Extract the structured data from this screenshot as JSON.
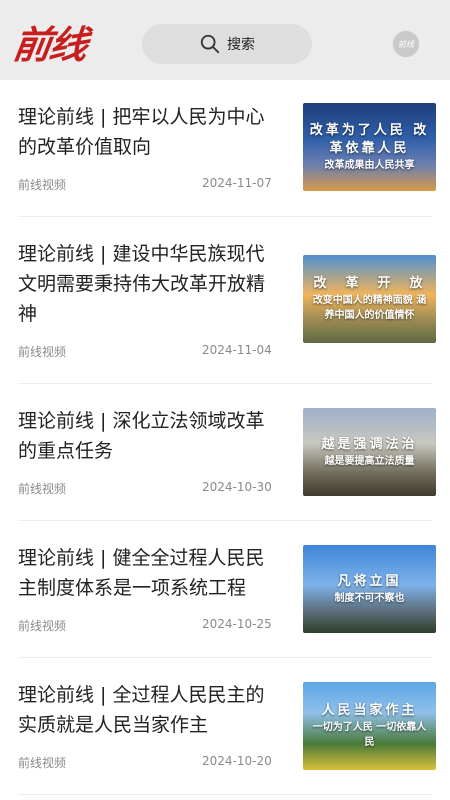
{
  "header": {
    "logo_text": "前线",
    "search_label": "搜索",
    "avatar_text": "前线"
  },
  "articles": [
    {
      "title": "理论前线 | 把牢以人民为中心的改革价值取向",
      "source": "前线视频",
      "date": "2024-11-07",
      "thumb_line1": "改革为了人民 改革依靠人民",
      "thumb_line2": "改革成果由人民共享"
    },
    {
      "title": "理论前线 | 建设中华民族现代文明需要秉持伟大改革开放精神",
      "source": "前线视频",
      "date": "2024-11-04",
      "thumb_line1": "改　革　开　放",
      "thumb_line2": "改变中国人的精神面貌 涵养中国人的价值情怀"
    },
    {
      "title": "理论前线 | 深化立法领域改革的重点任务",
      "source": "前线视频",
      "date": "2024-10-30",
      "thumb_line1": "越是强调法治",
      "thumb_line2": "越是要提高立法质量"
    },
    {
      "title": "理论前线 | 健全全过程人民民主制度体系是一项系统工程",
      "source": "前线视频",
      "date": "2024-10-25",
      "thumb_line1": "凡将立国",
      "thumb_line2": "制度不可不察也"
    },
    {
      "title": "理论前线 | 全过程人民民主的实质就是人民当家作主",
      "source": "前线视频",
      "date": "2024-10-20",
      "thumb_line1": "人民当家作主",
      "thumb_line2": "一切为了人民 一切依靠人民"
    }
  ]
}
